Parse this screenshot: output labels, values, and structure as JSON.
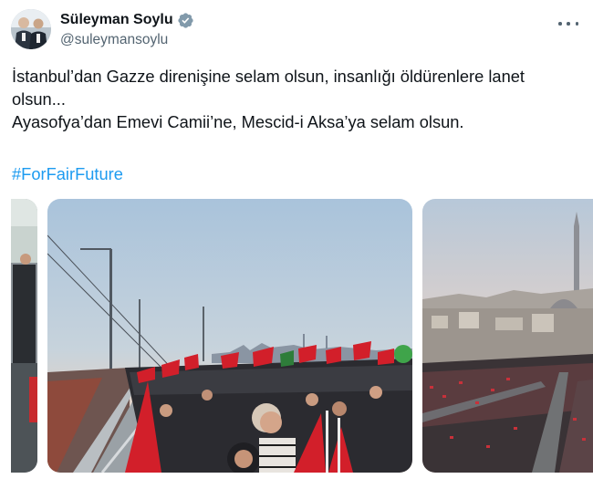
{
  "author": {
    "display_name": "Süleyman Soylu",
    "handle": "@suleymansoylu",
    "verified": true,
    "avatar_icon": "avatar-photo"
  },
  "menu": {
    "icon": "more-horizontal-icon"
  },
  "tweet": {
    "line1": "İstanbul’dan Gazze direnişine selam olsun, insanlığı öldürenlere lanet",
    "line2": "olsun...",
    "line3": "Ayasofya’dan Emevi Camii’ne, Mescid-i Aksa’ya selam olsun.",
    "hashtag": "#ForFairFuture"
  },
  "media": [
    {
      "name": "crowd-photo-partial"
    },
    {
      "name": "bridge-crowd-photo"
    },
    {
      "name": "city-crowd-photo"
    }
  ],
  "colors": {
    "link": "#1d9bf0",
    "verified": "#829aab",
    "secondary_text": "#536471",
    "flag_red": "#d21f2a"
  }
}
